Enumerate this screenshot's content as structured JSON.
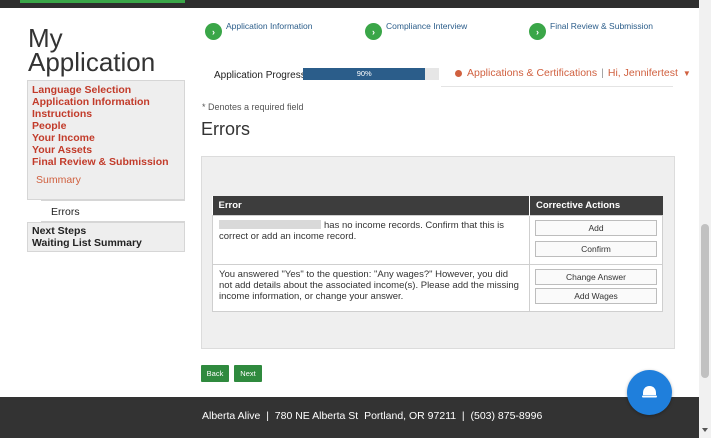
{
  "sidebar": {
    "title_line1": "My",
    "title_line2": "Application",
    "items": [
      {
        "label": "Language Selection"
      },
      {
        "label": "Application Information"
      },
      {
        "label": "Instructions"
      },
      {
        "label": "People"
      },
      {
        "label": "Your Income"
      },
      {
        "label": "Your Assets"
      },
      {
        "label": "Final Review & Submission"
      }
    ],
    "sub_item": "Summary",
    "active_item": "Errors",
    "bottom_items": [
      {
        "label": "Next Steps"
      },
      {
        "label": "Waiting List Summary"
      }
    ]
  },
  "steps": [
    {
      "label": "Application Information"
    },
    {
      "label": "Compliance Interview"
    },
    {
      "label": "Final Review & Submission"
    }
  ],
  "progress": {
    "label": "Application Progress",
    "value_text": "90%",
    "value": 90
  },
  "header": {
    "app_cert": "Applications & Certifications",
    "greeting": "Hi, Jennifertest"
  },
  "page": {
    "required_note": "* Denotes a required field",
    "title": "Errors"
  },
  "error_table": {
    "col_error": "Error",
    "col_actions": "Corrective Actions",
    "rows": [
      {
        "message": "has no income records. Confirm that this is correct or add an income record.",
        "actions": [
          "Add",
          "Confirm"
        ]
      },
      {
        "message": "You answered \"Yes\" to the question: \"Any wages?\" However, you did not add details about the associated income(s). Please add the missing income information, or change your answer.",
        "actions": [
          "Change Answer",
          "Add Wages"
        ]
      }
    ]
  },
  "buttons": {
    "back": "Back",
    "next": "Next"
  },
  "footer": {
    "text": "Alberta Alive  |  780 NE Alberta St  Portland, OR 97211  |  (503) 875-8996"
  },
  "colors": {
    "accent_red": "#c23b2a",
    "link_blue": "#2b5d8a",
    "brand_green": "#3aa648",
    "footer_bg": "#333333",
    "chat_blue": "#1f7fdc"
  }
}
